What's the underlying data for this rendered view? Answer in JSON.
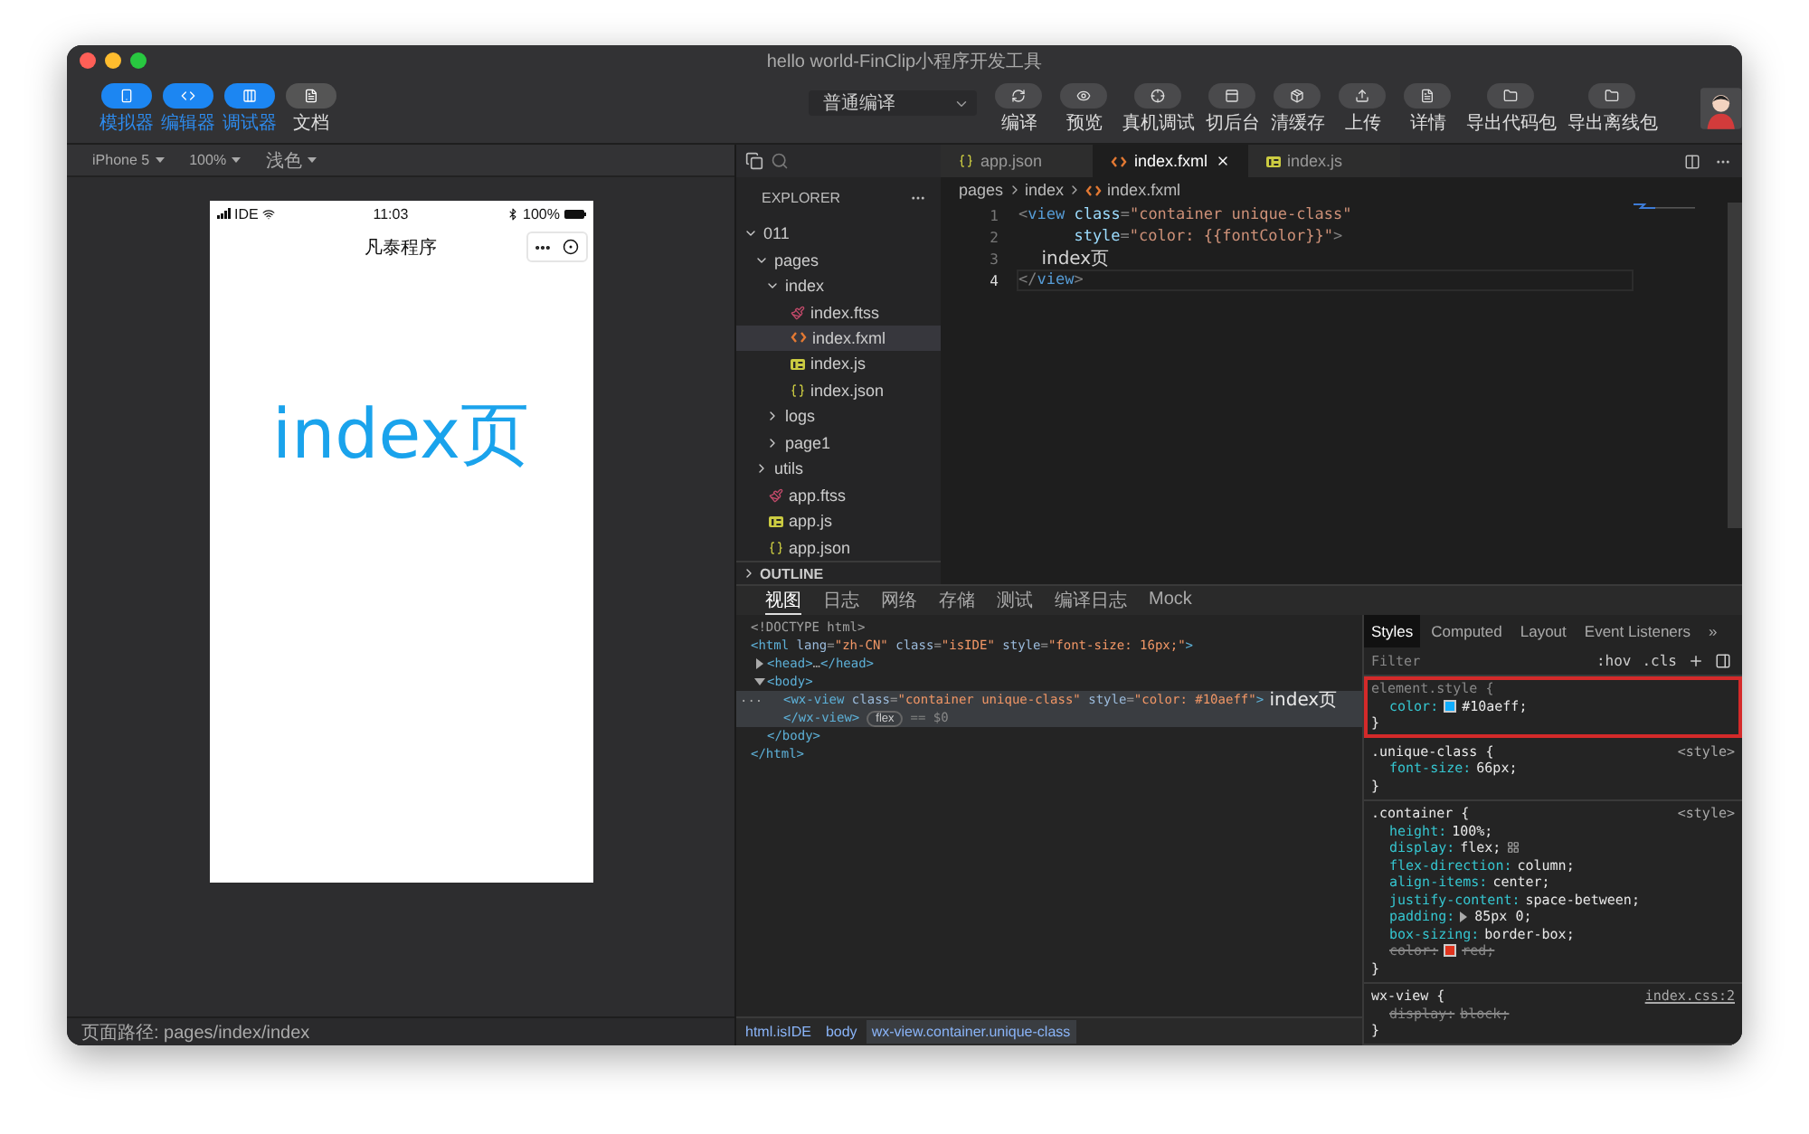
{
  "window": {
    "title": "hello world-FinClip小程序开发工具"
  },
  "toolbar": {
    "modes": [
      {
        "label": "模拟器",
        "kind": "phone",
        "selected": true
      },
      {
        "label": "编辑器",
        "kind": "code",
        "selected": true
      },
      {
        "label": "调试器",
        "kind": "debug",
        "selected": true
      },
      {
        "label": "文档",
        "kind": "doc",
        "selected": false
      }
    ],
    "compile_mode": {
      "value": "普通编译"
    },
    "actions": [
      {
        "label": "编译",
        "kind": "refresh"
      },
      {
        "label": "预览",
        "kind": "eye"
      },
      {
        "label": "真机调试",
        "kind": "target"
      },
      {
        "label": "切后台",
        "kind": "panel"
      },
      {
        "label": "清缓存",
        "kind": "box"
      },
      {
        "label": "上传",
        "kind": "upload"
      },
      {
        "label": "详情",
        "kind": "file"
      },
      {
        "label": "导出代码包",
        "kind": "folder"
      },
      {
        "label": "导出离线包",
        "kind": "folder"
      }
    ]
  },
  "simulator": {
    "device": "iPhone 5",
    "zoom": "100%",
    "theme": "浅色",
    "phone": {
      "carrier": "IDE",
      "time": "11:03",
      "battery": "100%",
      "nav_title": "凡泰程序",
      "content": "index页"
    },
    "page_path": "页面路径: pages/index/index"
  },
  "explorer": {
    "title": "EXPLORER",
    "tree": [
      {
        "label": "011",
        "kind": "folder",
        "expanded": true,
        "selected": false,
        "children": [
          {
            "label": "pages",
            "kind": "folder",
            "expanded": true,
            "selected": false,
            "children": [
              {
                "label": "index",
                "kind": "folder",
                "expanded": true,
                "selected": false,
                "children": [
                  {
                    "label": "index.ftss",
                    "kind": "ftss",
                    "selected": false
                  },
                  {
                    "label": "index.fxml",
                    "kind": "fxml",
                    "selected": true
                  },
                  {
                    "label": "index.js",
                    "kind": "js",
                    "selected": false
                  },
                  {
                    "label": "index.json",
                    "kind": "json",
                    "selected": false
                  }
                ]
              },
              {
                "label": "logs",
                "kind": "folder",
                "expanded": false,
                "selected": false
              },
              {
                "label": "page1",
                "kind": "folder",
                "expanded": false,
                "selected": false
              }
            ]
          },
          {
            "label": "utils",
            "kind": "folder",
            "expanded": false,
            "selected": false
          },
          {
            "label": "app.ftss",
            "kind": "ftss",
            "selected": false
          },
          {
            "label": "app.js",
            "kind": "js",
            "selected": false
          },
          {
            "label": "app.json",
            "kind": "json",
            "selected": false
          }
        ]
      }
    ],
    "outline": {
      "label": "OUTLINE",
      "expanded": false
    }
  },
  "editor": {
    "tabs": [
      {
        "label": "app.json",
        "kind": "json",
        "selected": false
      },
      {
        "label": "index.fxml",
        "kind": "fxml",
        "selected": true
      },
      {
        "label": "index.js",
        "kind": "js",
        "selected": false
      }
    ],
    "breadcrumb": [
      {
        "label": "pages",
        "kind": "folder"
      },
      {
        "label": "index",
        "kind": "folder"
      },
      {
        "label": "index.fxml",
        "kind": "fxml"
      }
    ],
    "lines": [
      {
        "number": "1",
        "current": false,
        "tokens": [
          {
            "kind": "punct",
            "t": "<"
          },
          {
            "kind": "tag",
            "t": "view"
          },
          {
            "kind": "attr",
            "t": " class"
          },
          {
            "kind": "punct",
            "t": "="
          },
          {
            "kind": "str",
            "t": "\"container unique-class\""
          }
        ]
      },
      {
        "number": "2",
        "current": false,
        "tokens": [
          {
            "kind": "attr",
            "t": "      style"
          },
          {
            "kind": "punct",
            "t": "="
          },
          {
            "kind": "str",
            "t": "\"color: {{fontColor}}\""
          },
          {
            "kind": "punct",
            "t": ">"
          }
        ]
      },
      {
        "number": "3",
        "current": false,
        "tokens": [
          {
            "kind": "text",
            "t": "    index页"
          }
        ]
      },
      {
        "number": "4",
        "current": true,
        "tokens": [
          {
            "kind": "punct",
            "t": "</"
          },
          {
            "kind": "tag",
            "t": "view"
          },
          {
            "kind": "punct",
            "t": ">"
          }
        ]
      }
    ]
  },
  "devtools": {
    "tabs": [
      {
        "label": "视图",
        "selected": true
      },
      {
        "label": "日志",
        "selected": false
      },
      {
        "label": "网络",
        "selected": false
      },
      {
        "label": "存储",
        "selected": false
      },
      {
        "label": "测试",
        "selected": false
      },
      {
        "label": "编译日志",
        "selected": false
      },
      {
        "label": "Mock",
        "selected": false
      }
    ],
    "dom": [
      {
        "selected": false,
        "tokens": [
          {
            "kind": "punct",
            "t": "<!DOCTYPE html>"
          }
        ]
      },
      {
        "selected": false,
        "tokens": [
          {
            "kind": "tag",
            "t": "<html"
          },
          {
            "kind": "attr",
            "t": " lang"
          },
          {
            "kind": "punct",
            "t": "="
          },
          {
            "kind": "str",
            "t": "\"zh-CN\""
          },
          {
            "kind": "attr",
            "t": " class"
          },
          {
            "kind": "punct",
            "t": "="
          },
          {
            "kind": "str",
            "t": "\"isIDE\""
          },
          {
            "kind": "attr",
            "t": " style"
          },
          {
            "kind": "punct",
            "t": "="
          },
          {
            "kind": "str",
            "t": "\"font-size: 16px;\""
          },
          {
            "kind": "tag",
            "t": ">"
          }
        ],
        "close": [
          {
            "kind": "tag",
            "t": "</html>"
          }
        ],
        "children": [
          {
            "selected": false,
            "expanded": false,
            "tokens": [
              {
                "kind": "tag",
                "t": "<head>"
              },
              {
                "kind": "punct",
                "t": "…"
              },
              {
                "kind": "tag",
                "t": "</head>"
              }
            ]
          },
          {
            "selected": false,
            "expanded": true,
            "tokens": [
              {
                "kind": "tag",
                "t": "<body>"
              }
            ],
            "close": [
              {
                "kind": "tag",
                "t": "</body>"
              }
            ],
            "children": [
              {
                "selected": true,
                "gutter": "...",
                "badge": "flex",
                "note": "== $0",
                "tokens": [
                  {
                    "kind": "tag",
                    "t": "<wx-view"
                  },
                  {
                    "kind": "attr",
                    "t": " class"
                  },
                  {
                    "kind": "punct",
                    "t": "="
                  },
                  {
                    "kind": "str",
                    "t": "\"container unique-class\""
                  },
                  {
                    "kind": "attr",
                    "t": " style"
                  },
                  {
                    "kind": "punct",
                    "t": "="
                  },
                  {
                    "kind": "str",
                    "t": "\"color: #10aeff\""
                  },
                  {
                    "kind": "tag",
                    "t": ">"
                  },
                  {
                    "kind": "text",
                    "t": " index页"
                  }
                ],
                "close": [
                  {
                    "kind": "tag",
                    "t": "</wx-view>"
                  }
                ]
              }
            ]
          }
        ]
      }
    ],
    "dom_path": [
      {
        "label": "html.isIDE",
        "selected": false
      },
      {
        "label": "body",
        "selected": false
      },
      {
        "label": "wx-view.container.unique-class",
        "selected": true
      }
    ],
    "styles": {
      "tabs": [
        {
          "label": "Styles",
          "selected": true
        },
        {
          "label": "Computed",
          "selected": false
        },
        {
          "label": "Layout",
          "selected": false
        },
        {
          "label": "Event Listeners",
          "selected": false
        }
      ],
      "more": "»",
      "filter": {
        "placeholder": "Filter"
      },
      "hov": ":hov",
      "cls": ".cls",
      "rules": [
        {
          "selector": "element.style {",
          "kind": "inline",
          "highlighted": true,
          "end": "}",
          "decls": [
            {
              "prop": "color:",
              "value": "#10aeff;",
              "kind": "color",
              "color": "#10aeff",
              "struck": false
            }
          ]
        },
        {
          "selector": ".unique-class {",
          "kind": "rule",
          "source": "<style>",
          "linked": false,
          "highlighted": false,
          "end": "}",
          "decls": [
            {
              "prop": "font-size:",
              "value": "66px;",
              "kind": "plain",
              "struck": false
            }
          ]
        },
        {
          "selector": ".container {",
          "kind": "rule",
          "source": "<style>",
          "linked": false,
          "highlighted": false,
          "end": "}",
          "decls": [
            {
              "prop": "height:",
              "value": "100%;",
              "kind": "plain",
              "struck": false
            },
            {
              "prop": "display:",
              "value": "flex;",
              "kind": "flex",
              "struck": false
            },
            {
              "prop": "flex-direction:",
              "value": "column;",
              "kind": "plain",
              "struck": false
            },
            {
              "prop": "align-items:",
              "value": "center;",
              "kind": "plain",
              "struck": false
            },
            {
              "prop": "justify-content:",
              "value": "space-between;",
              "kind": "plain",
              "struck": false
            },
            {
              "prop": "padding:",
              "value": "85px 0;",
              "kind": "expand",
              "struck": false
            },
            {
              "prop": "box-sizing:",
              "value": "border-box;",
              "kind": "plain",
              "struck": false
            },
            {
              "prop": "color:",
              "value": "red;",
              "kind": "color",
              "color": "#e0341e",
              "struck": true
            }
          ]
        },
        {
          "selector": "wx-view {",
          "kind": "rule",
          "source": "index.css:2",
          "linked": true,
          "highlighted": false,
          "end": "}",
          "decls": [
            {
              "prop": "display:",
              "value": "block;",
              "kind": "plain",
              "struck": true
            }
          ]
        }
      ]
    }
  }
}
